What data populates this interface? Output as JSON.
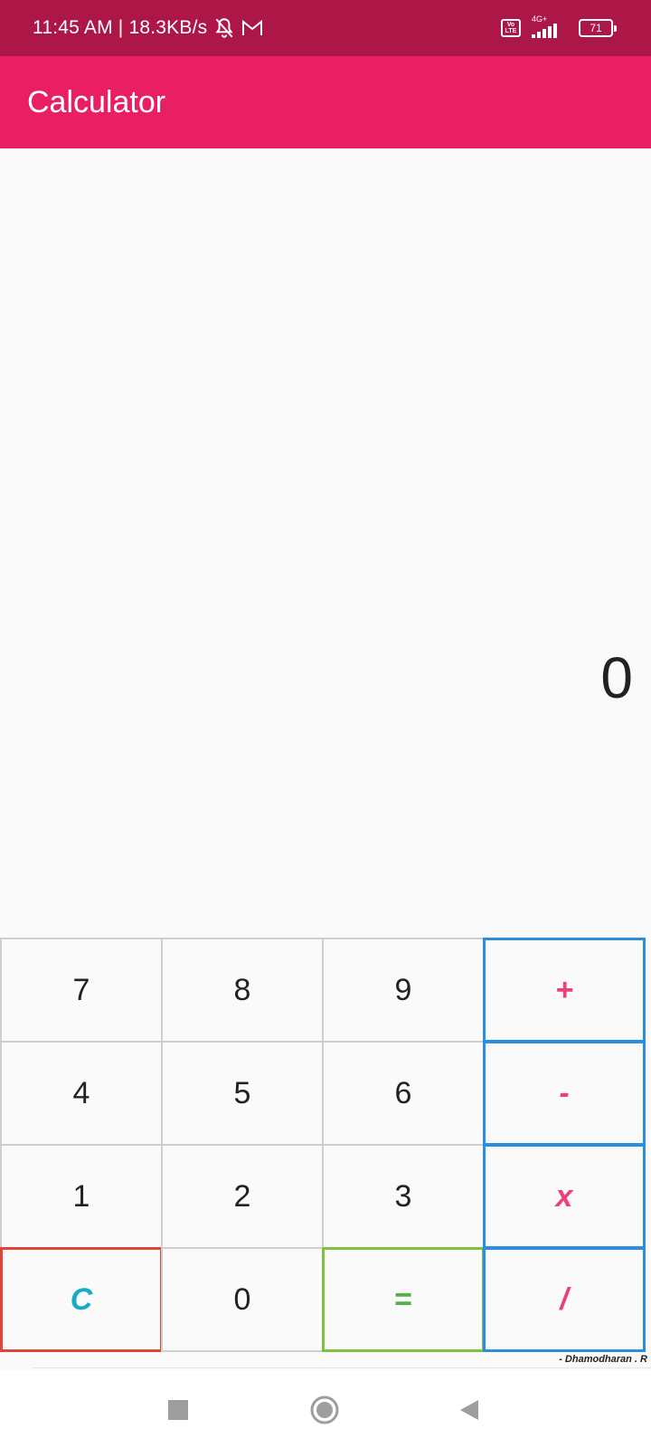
{
  "status_bar": {
    "time": "11:45 AM | 18.3KB/s",
    "network_type": "4G+",
    "volte": [
      "Vo",
      "LTE"
    ],
    "battery": "71",
    "icons": [
      "bell-off-icon",
      "gmail-icon",
      "volte-icon",
      "signal-icon",
      "battery-icon"
    ]
  },
  "app_bar": {
    "title": "Calculator"
  },
  "display": {
    "value": "0"
  },
  "keypad": {
    "keys": [
      {
        "label": "7",
        "type": "digit"
      },
      {
        "label": "8",
        "type": "digit"
      },
      {
        "label": "9",
        "type": "digit"
      },
      {
        "label": "+",
        "type": "operator"
      },
      {
        "label": "4",
        "type": "digit"
      },
      {
        "label": "5",
        "type": "digit"
      },
      {
        "label": "6",
        "type": "digit"
      },
      {
        "label": "-",
        "type": "operator"
      },
      {
        "label": "1",
        "type": "digit"
      },
      {
        "label": "2",
        "type": "digit"
      },
      {
        "label": "3",
        "type": "digit"
      },
      {
        "label": "x",
        "type": "operator"
      },
      {
        "label": "C",
        "type": "clear"
      },
      {
        "label": "0",
        "type": "digit"
      },
      {
        "label": "=",
        "type": "equals"
      },
      {
        "label": "/",
        "type": "operator"
      }
    ]
  },
  "footer": {
    "credit": "-  Dhamodharan . R"
  },
  "colors": {
    "status_bar": "#ad1747",
    "app_bar": "#e91e63",
    "operator_border": "#2b8ee0",
    "operator_text": "#ec407a",
    "clear_border": "#e0443a",
    "clear_text": "#1aa9c7",
    "equals_border": "#7dc142",
    "equals_text": "#56b04a"
  },
  "nav_bar": {
    "icons": [
      "recents-square-icon",
      "home-circle-icon",
      "back-triangle-icon"
    ]
  }
}
